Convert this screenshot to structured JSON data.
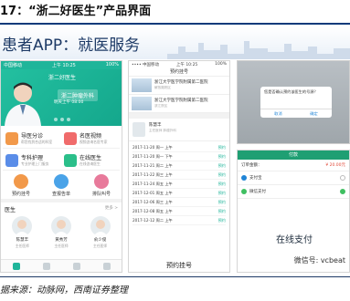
{
  "figure": {
    "title": "17：“浙二好医生”产品界面",
    "banner_title": "患者APP：就医服务",
    "source": "据来源：动脉网，西南证券整理"
  },
  "screen_main": {
    "status_left": "中国移动",
    "status_time": "上午 10:25",
    "status_right": "100%",
    "app_name": "浙二好医生",
    "hero_sub": "浙二肿瘤外科",
    "hero_line": "明天上午 08:00",
    "tiles": [
      {
        "label": "导医分诊",
        "sub": "帮您找到合适的科室",
        "color": "#f2994a"
      },
      {
        "label": "名医视频",
        "sub": "视频咨询名医专家",
        "color": "#f06b6b"
      },
      {
        "label": "专科护理",
        "sub": "专业护理上门服务",
        "color": "#5a8de8"
      },
      {
        "label": "在线医生",
        "sub": "在线咨询医生",
        "color": "#2bbf8a"
      }
    ],
    "quick": [
      {
        "label": "预约挂号",
        "color": "#f2994a"
      },
      {
        "label": "查报告单",
        "color": "#4aa3e8"
      },
      {
        "label": "排队叫号",
        "color": "#e87a9b"
      }
    ],
    "doctor_header": "医生",
    "doctor_more": "更多 >",
    "doctors": [
      {
        "name": "陈慧丰",
        "title": "主任医师"
      },
      {
        "name": "黄秀芳",
        "title": "主任医师"
      },
      {
        "name": "俞少俊",
        "title": "主任医师"
      }
    ]
  },
  "screen_booking": {
    "status_left": "•••• 中国移动",
    "status_time": "上午 10:25",
    "status_right": "100%",
    "nav_title": "预约挂号",
    "hospitals": [
      {
        "name": "浙江大学医学院附属第二医院",
        "sub": "解放路院区"
      },
      {
        "name": "浙江大学医学院附属第二医院",
        "sub": "滨江院区"
      }
    ],
    "doctor_name": "陈慧丰",
    "doctor_dept": "主任医师 肿瘤外科",
    "slots": [
      {
        "date": "2017-11-20 周一 上午",
        "action": "预约"
      },
      {
        "date": "2017-11-20 周一 下午",
        "action": "预约"
      },
      {
        "date": "2017-11-21 周二 上午",
        "action": "预约"
      },
      {
        "date": "2017-11-22 周三 上午",
        "action": "预约"
      },
      {
        "date": "2017-11-24 周五 上午",
        "action": "预约"
      },
      {
        "date": "2017-12-01 周五 上午",
        "action": "预约"
      },
      {
        "date": "2017-12-06 周三 上午",
        "action": "预约"
      },
      {
        "date": "2017-12-08 周五 上午",
        "action": "预约"
      },
      {
        "date": "2017-12-12 周二 上午",
        "action": "预约"
      }
    ],
    "caption": "预约挂号"
  },
  "screen_pay": {
    "dialog_text": "您是否确认预约该医生的号源？",
    "dialog_cancel": "取消",
    "dialog_ok": "确定",
    "bar_title": "付款",
    "amount_label": "订单金额：",
    "amount_value": "¥ 20.00元",
    "options": [
      {
        "label": "支付宝",
        "selected": false
      },
      {
        "label": "微信支付",
        "selected": true
      }
    ],
    "pay_button": "在线支付",
    "watermark": "微信号: vcbeat"
  }
}
